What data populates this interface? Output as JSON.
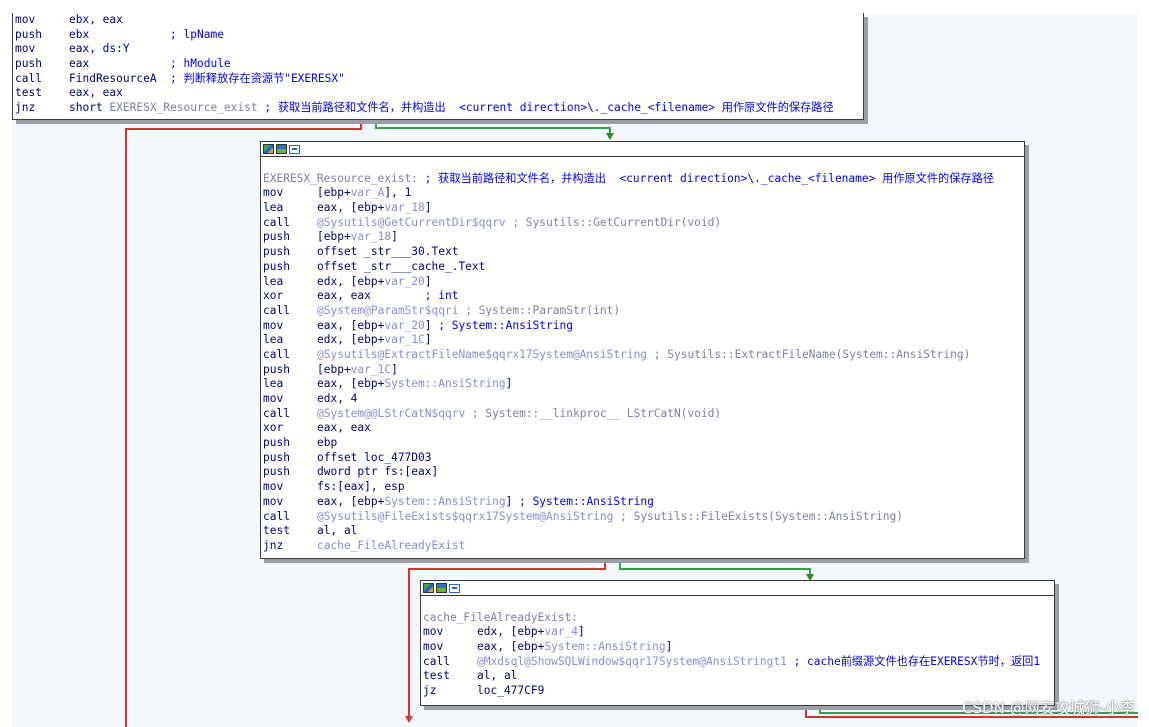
{
  "node1": {
    "lines": [
      {
        "mn": "mov",
        "ops": "ebx, eax",
        "cm": ""
      },
      {
        "mn": "push",
        "ops": "ebx            ",
        "cm": "; lpName"
      },
      {
        "mn": "mov",
        "ops": "eax, ds:Y",
        "cm": ""
      },
      {
        "mn": "push",
        "ops": "eax            ",
        "cm": "; hModule"
      },
      {
        "mn": "call",
        "ops": "FindResourceA  ",
        "cm": "; 判断释放存在资源节\"EXERESX\""
      },
      {
        "mn": "test",
        "ops": "eax, eax",
        "cm": ""
      },
      {
        "mn": "jnz",
        "ops": "short ",
        "sym": "EXERESX_Resource_exist",
        "cm": " ; 获取当前路径和文件名，并构造出  <current direction>\\._cache_<filename> 用作原文件的保存路径"
      }
    ]
  },
  "node2": {
    "label": "EXERESX_Resource_exist:",
    "label_comment": " ; 获取当前路径和文件名，并构造出  <current direction>\\._cache_<filename> 用作原文件的保存路径",
    "lines": [
      {
        "mn": "mov",
        "pre": "[ebp+",
        "sym": "var_A",
        "post": "], 1",
        "gray": "",
        "cm": ""
      },
      {
        "mn": "lea",
        "pre": "eax, [ebp+",
        "sym": "var_18",
        "post": "]",
        "gray": "",
        "cm": ""
      },
      {
        "mn": "call",
        "pre": "",
        "sym": "@Sysutils@GetCurrentDir$qqrv",
        "post": "",
        "gray": " ; Sysutils::GetCurrentDir(void)",
        "cm": ""
      },
      {
        "mn": "push",
        "pre": "[ebp+",
        "sym": "var_18",
        "post": "]",
        "gray": "",
        "cm": ""
      },
      {
        "mn": "push",
        "pre": "offset _str___30.Text",
        "sym": "",
        "post": "",
        "gray": "",
        "cm": ""
      },
      {
        "mn": "push",
        "pre": "offset _str___cache_.Text",
        "sym": "",
        "post": "",
        "gray": "",
        "cm": ""
      },
      {
        "mn": "lea",
        "pre": "edx, [ebp+",
        "sym": "var_20",
        "post": "]",
        "gray": "",
        "cm": ""
      },
      {
        "mn": "xor",
        "pre": "eax, eax        ",
        "sym": "",
        "post": "",
        "gray": "",
        "cm": "; int"
      },
      {
        "mn": "call",
        "pre": "",
        "sym": "@System@ParamStr$qqri",
        "post": "",
        "gray": " ; System::ParamStr(int)",
        "cm": ""
      },
      {
        "mn": "mov",
        "pre": "eax, [ebp+",
        "sym": "var_20",
        "post": "] ",
        "gray": "",
        "cm": "; System::AnsiString"
      },
      {
        "mn": "lea",
        "pre": "edx, [ebp+",
        "sym": "var_1C",
        "post": "]",
        "gray": "",
        "cm": ""
      },
      {
        "mn": "call",
        "pre": "",
        "sym": "@Sysutils@ExtractFileName$qqrx17System@AnsiString",
        "post": "",
        "gray": " ; Sysutils::ExtractFileName(System::AnsiString)",
        "cm": ""
      },
      {
        "mn": "push",
        "pre": "[ebp+",
        "sym": "var_1C",
        "post": "]",
        "gray": "",
        "cm": ""
      },
      {
        "mn": "lea",
        "pre": "eax, [ebp+",
        "sym": "System::AnsiString",
        "post": "]",
        "gray": "",
        "cm": ""
      },
      {
        "mn": "mov",
        "pre": "edx, 4",
        "sym": "",
        "post": "",
        "gray": "",
        "cm": ""
      },
      {
        "mn": "call",
        "pre": "",
        "sym": "@System@@LStrCatN$qqrv",
        "post": "",
        "gray": " ; System::__linkproc__ LStrCatN(void)",
        "cm": ""
      },
      {
        "mn": "xor",
        "pre": "eax, eax",
        "sym": "",
        "post": "",
        "gray": "",
        "cm": ""
      },
      {
        "mn": "push",
        "pre": "ebp",
        "sym": "",
        "post": "",
        "gray": "",
        "cm": ""
      },
      {
        "mn": "push",
        "pre": "offset loc_477D03",
        "sym": "",
        "post": "",
        "gray": "",
        "cm": ""
      },
      {
        "mn": "push",
        "pre": "dword ptr fs:[eax]",
        "sym": "",
        "post": "",
        "gray": "",
        "cm": ""
      },
      {
        "mn": "mov",
        "pre": "fs:[eax], esp",
        "sym": "",
        "post": "",
        "gray": "",
        "cm": ""
      },
      {
        "mn": "mov",
        "pre": "eax, [ebp+",
        "sym": "System::AnsiString",
        "post": "] ",
        "gray": "",
        "cm": "; System::AnsiString"
      },
      {
        "mn": "call",
        "pre": "",
        "sym": "@Sysutils@FileExists$qqrx17System@AnsiString",
        "post": "",
        "gray": " ; Sysutils::FileExists(System::AnsiString)",
        "cm": ""
      },
      {
        "mn": "test",
        "pre": "al, al",
        "sym": "",
        "post": "",
        "gray": "",
        "cm": ""
      },
      {
        "mn": "jnz",
        "pre": "",
        "sym": "cache_FileAlreadyExist",
        "post": "",
        "gray": "",
        "cm": ""
      }
    ]
  },
  "node3": {
    "label": "cache_FileAlreadyExist:",
    "lines": [
      {
        "mn": "mov",
        "pre": "edx, [ebp+",
        "sym": "var_4",
        "post": "]",
        "gray": "",
        "cm": ""
      },
      {
        "mn": "mov",
        "pre": "eax, [ebp+",
        "sym": "System::AnsiString",
        "post": "]",
        "gray": "",
        "cm": ""
      },
      {
        "mn": "call",
        "pre": "",
        "sym": "@Mxdsql@ShowSQLWindow$qqr17System@AnsiStringt1",
        "post": "",
        "gray": "",
        "cm": " ; cache前缀源文件也存在EXERESX节时，返回1"
      },
      {
        "mn": "test",
        "pre": "al, al",
        "sym": "",
        "post": "",
        "gray": "",
        "cm": ""
      },
      {
        "mn": "jz",
        "pre": "loc_477CF9",
        "sym": "",
        "post": "",
        "gray": "",
        "cm": ""
      }
    ]
  },
  "watermark": "CSDN @网安攻城狮-小李",
  "colors": {
    "true_edge": "#2fa24a",
    "false_edge": "#d9312b",
    "comment": "#0000ff",
    "mnemonic": "#000080"
  }
}
